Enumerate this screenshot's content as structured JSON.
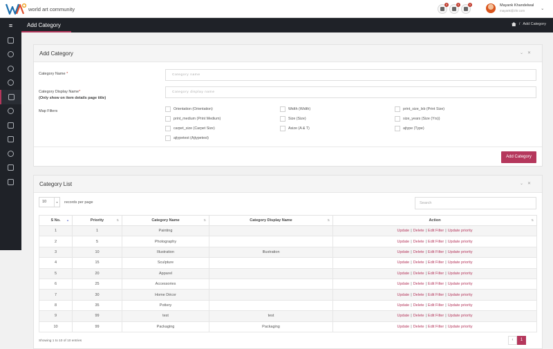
{
  "brand": {
    "name": "world art community"
  },
  "notifications": [
    {
      "icon": "bell-icon",
      "count": "0"
    },
    {
      "icon": "calendar-icon",
      "count": "0"
    },
    {
      "icon": "list-icon",
      "count": "0"
    }
  ],
  "user": {
    "name": "Mayank Khandelwal",
    "email": "mayank@zhr.com"
  },
  "header": {
    "title": "Add Category",
    "breadcrumb": "Add Category"
  },
  "form": {
    "title": "Add Category",
    "category_name_label": "Category Name",
    "category_name_placeholder": "Category name",
    "display_name_label": "Category Display Name",
    "display_name_note": "(Only show on item details page title)",
    "display_name_placeholder": "Category display name",
    "map_filters_label": "Map Filters",
    "filters": [
      "Orientation (Orientation)",
      "Width (Width)",
      "print_size_lxb (Print Size)",
      "print_medium (Print Medium)",
      "Size (Size)",
      "size_years (Size (Yrs))",
      "carpet_size (Carpet Size)",
      "Asize (A & T)",
      "ajtype (Type)",
      "ajtypetest (Ajtypetest)"
    ],
    "submit_label": "Add Category"
  },
  "list": {
    "title": "Category List",
    "page_length": "10",
    "page_length_label": "records per page",
    "search_placeholder": "Search",
    "columns": [
      "S No.",
      "Priority",
      "Category Name",
      "Category Display Name",
      "Action"
    ],
    "actions": [
      "Update",
      "Delete",
      "Edit Filter",
      "Update priority"
    ],
    "rows": [
      {
        "sno": "1",
        "priority": "1",
        "name": "Painting",
        "display": ""
      },
      {
        "sno": "2",
        "priority": "5",
        "name": "Photography",
        "display": ""
      },
      {
        "sno": "3",
        "priority": "10",
        "name": "Illustration",
        "display": "Illustration"
      },
      {
        "sno": "4",
        "priority": "15",
        "name": "Sculpture",
        "display": ""
      },
      {
        "sno": "5",
        "priority": "20",
        "name": "Apparel",
        "display": ""
      },
      {
        "sno": "6",
        "priority": "25",
        "name": "Accessories",
        "display": ""
      },
      {
        "sno": "7",
        "priority": "30",
        "name": "Home Décor",
        "display": ""
      },
      {
        "sno": "8",
        "priority": "35",
        "name": "Pottery",
        "display": ""
      },
      {
        "sno": "9",
        "priority": "99",
        "name": "test",
        "display": "test"
      },
      {
        "sno": "10",
        "priority": "99",
        "name": "Packaging",
        "display": "Packaging"
      }
    ],
    "info": "Showing 1 to 10 of 10 entries",
    "pagination": {
      "prev": "‹",
      "current": "1"
    }
  },
  "colors": {
    "accent": "#b5375c",
    "sidebar": "#1f2228"
  }
}
